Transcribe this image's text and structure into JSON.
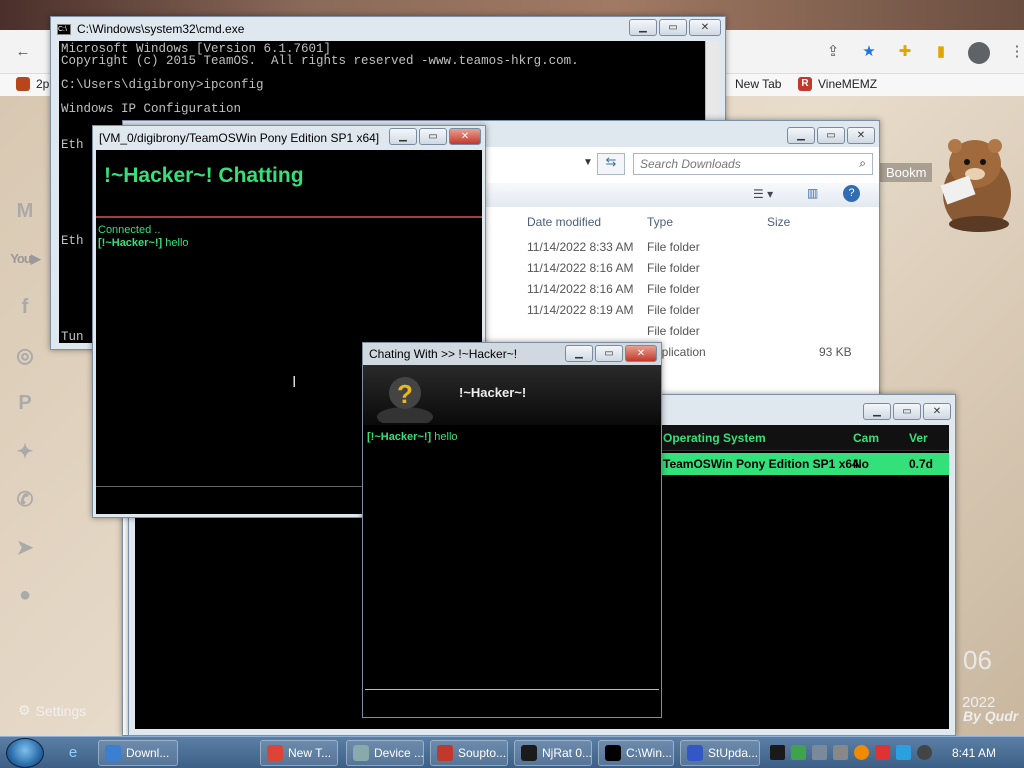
{
  "browser": {
    "bookmarks": [
      {
        "label": "2p"
      },
      {
        "label": "New Tab"
      },
      {
        "label": "VineMEMZ"
      }
    ],
    "bookmark_side": "Bookm"
  },
  "desktop": {
    "settings": "Settings",
    "date_day": "06",
    "date_year": "2022",
    "by_text": "By Qudr"
  },
  "cmd": {
    "title": "C:\\Windows\\system32\\cmd.exe",
    "lines": [
      "Microsoft Windows [Version 6.1.7601]",
      "Copyright (c) 2015 TeamOS.  All rights reserved -www.teamos-hkrg.com.",
      "",
      "C:\\Users\\digibrony>ipconfig",
      "",
      "Windows IP Configuration",
      "",
      "",
      "Eth",
      "",
      "",
      "",
      "",
      "",
      "",
      "",
      "Eth",
      "",
      "",
      "",
      "",
      "",
      "",
      "",
      "Tun"
    ]
  },
  "explorer": {
    "search_placeholder": "Search Downloads",
    "columns": {
      "date": "Date modified",
      "type": "Type",
      "size": "Size"
    },
    "rows": [
      {
        "date": "11/14/2022 8:33 AM",
        "type": "File folder",
        "size": ""
      },
      {
        "date": "11/14/2022 8:16 AM",
        "type": "File folder",
        "size": ""
      },
      {
        "date": "11/14/2022 8:16 AM",
        "type": "File folder",
        "size": ""
      },
      {
        "date": "11/14/2022 8:19 AM",
        "type": "File folder",
        "size": ""
      },
      {
        "date": "",
        "type": "File folder",
        "size": ""
      },
      {
        "date": "",
        "type": "Application",
        "size": "93 KB"
      }
    ]
  },
  "hacker_chat": {
    "title": "[VM_0/digibrony/TeamOSWin Pony Edition SP1 x64]",
    "heading": "!~Hacker~! Chatting",
    "status": "Connected ..",
    "message_sender": "[!~Hacker~!]",
    "message_text": "hello"
  },
  "chat_with": {
    "title": "Chating With >> !~Hacker~!",
    "name": "!~Hacker~!",
    "message_sender": "[!~Hacker~!]",
    "message_text": "hello"
  },
  "njrat": {
    "columns": {
      "os": "Operating System",
      "cam": "Cam",
      "ver": "Ver"
    },
    "row": {
      "os": "TeamOSWin Pony Edition SP1 x64",
      "cam": "No",
      "ver": "0.7d"
    }
  },
  "taskbar": {
    "items": [
      {
        "label": "Downl..."
      },
      {
        "label": "New T..."
      },
      {
        "label": "Device ..."
      },
      {
        "label": "Soupto..."
      },
      {
        "label": "NjRat 0..."
      },
      {
        "label": "C:\\Win..."
      },
      {
        "label": "StUpda..."
      }
    ],
    "clock": "8:41 AM"
  },
  "colors": {
    "terminal_green": "#33e07a",
    "accent_red": "#c0392b"
  }
}
